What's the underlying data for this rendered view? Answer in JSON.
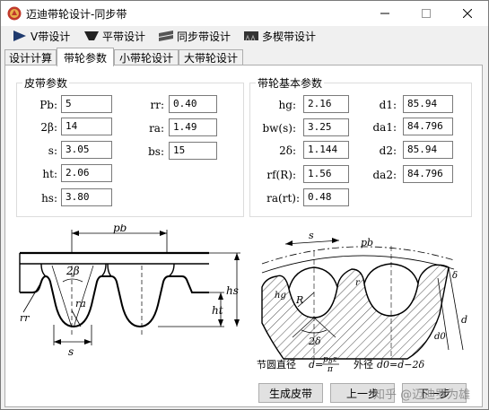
{
  "window": {
    "title": "迈迪带轮设计-同步带"
  },
  "toolbar": {
    "items": [
      "V带设计",
      "平带设计",
      "同步带设计",
      "多楔带设计"
    ]
  },
  "tabs": [
    "设计计算",
    "带轮参数",
    "小带轮设计",
    "大带轮设计"
  ],
  "active_tab": 1,
  "belt_params": {
    "legend": "皮带参数",
    "pb": {
      "label": "Pb:",
      "value": "5"
    },
    "two_beta": {
      "label": "2β:",
      "value": "14"
    },
    "s": {
      "label": "s:",
      "value": "3.05"
    },
    "ht": {
      "label": "ht:",
      "value": "2.06"
    },
    "hs": {
      "label": "hs:",
      "value": "3.80"
    },
    "rr": {
      "label": "rr:",
      "value": "0.40"
    },
    "ra": {
      "label": "ra:",
      "value": "1.49"
    },
    "bs": {
      "label": "bs:",
      "value": "15"
    }
  },
  "pulley_params": {
    "legend": "带轮基本参数",
    "hg": {
      "label": "hg:",
      "value": "2.16"
    },
    "bw": {
      "label": "bw(s):",
      "value": "3.25"
    },
    "two_delta": {
      "label": "2δ:",
      "value": "1.144"
    },
    "rf": {
      "label": "rf(R):",
      "value": "1.56"
    },
    "ra_rt": {
      "label": "ra(rt):",
      "value": "0.48"
    },
    "d1": {
      "label": "d1:",
      "value": "85.94"
    },
    "da1": {
      "label": "da1:",
      "value": "84.796"
    },
    "d2": {
      "label": "d2:",
      "value": "85.94"
    },
    "da2": {
      "label": "da2:",
      "value": "84.796"
    }
  },
  "figure_left": {
    "labels": [
      "pb",
      "2β",
      "rr",
      "ra",
      "ht",
      "hs",
      "s"
    ]
  },
  "figure_right": {
    "labels": [
      "s",
      "pb",
      "hg",
      "R",
      "r",
      "2δ",
      "δ",
      "d",
      "d0"
    ],
    "caption_pitch": "节圆直径",
    "caption_outer": "外径",
    "formula_outer": "d0=d−2δ"
  },
  "buttons": {
    "generate": "生成皮带",
    "prev": "上一步",
    "next": "下一步"
  },
  "watermark": "知乎 @迈迪罗为雄"
}
